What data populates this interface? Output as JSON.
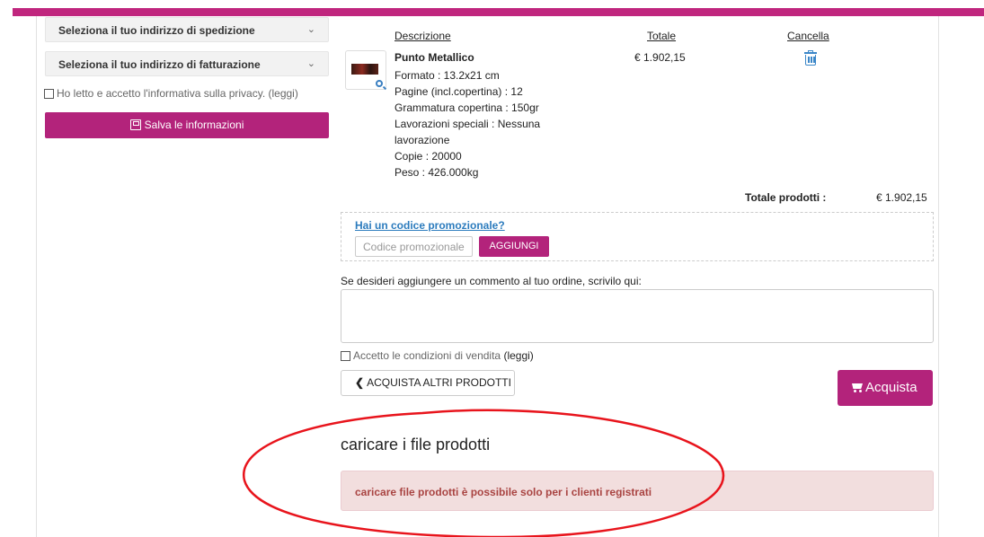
{
  "left": {
    "shipping_accordion": "Seleziona il tuo indirizzo di spedizione",
    "billing_accordion": "Seleziona il tuo indirizzo di fatturazione",
    "privacy_text": "Ho letto e accetto l'informativa sulla privacy. (leggi)",
    "save_button": "Salva le informazioni"
  },
  "cart": {
    "headers": {
      "description": "Descrizione",
      "total": "Totale",
      "delete": "Cancella"
    },
    "item": {
      "name": "Punto Metallico",
      "lines": [
        "Formato : 13.2x21 cm",
        "Pagine (incl.copertina) : 12",
        "Grammatura copertina : 150gr",
        "Lavorazioni speciali : Nessuna lavorazione",
        "Copie : 20000",
        "Peso : 426.000kg"
      ],
      "price": "€ 1.902,15"
    },
    "total_label": "Totale prodotti :",
    "total_value": "€ 1.902,15"
  },
  "promo": {
    "title": "Hai un codice promozionale?",
    "placeholder": "Codice promozionale",
    "button": "AGGIUNGI"
  },
  "comment": {
    "label": "Se desideri aggiungere un commento al tuo ordine, scrivilo qui:"
  },
  "terms": {
    "text": "Accetto le condizioni di vendita",
    "link": "(leggi)"
  },
  "actions": {
    "back": "ACQUISTA ALTRI PRODOTTI",
    "buy": "Acquista"
  },
  "upload": {
    "title": "caricare i file prodotti",
    "alert": "caricare file prodotti è possibile solo per i clienti registrati"
  },
  "colors": {
    "brand": "#b3237b",
    "link": "#2b7bbd",
    "alert_bg": "#f2dede",
    "alert_text": "#a94442",
    "annotation": "#e8141c"
  }
}
